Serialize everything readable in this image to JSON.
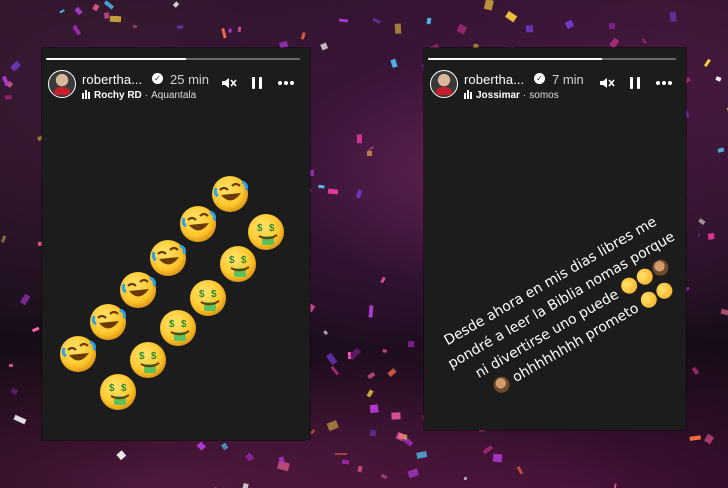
{
  "stories": [
    {
      "username": "robertha...",
      "time": "25 min",
      "song": "Rochy RD",
      "artist": "Aquantala",
      "progress_fraction": 0.55,
      "emojis": {
        "rofl_count": 7,
        "money_face_count": 7
      }
    },
    {
      "username": "robertha...",
      "time": "7 min",
      "song": "Jossimar",
      "artist": "somos",
      "progress_fraction": 0.7,
      "text_lines": [
        "Desde ahora en mis dias libres me",
        "pondré a leer la Biblia nomas porque",
        "ni divertirse uno puede",
        "ohhhhhhhh prometo"
      ]
    }
  ],
  "icons": {
    "verified": "verified-badge-icon",
    "music": "music-bars-icon",
    "mute": "speaker-muted-icon",
    "pause": "pause-icon",
    "more": "more-dots-icon",
    "rofl": "rolling-laughing-emoji",
    "money": "money-mouth-face-emoji",
    "man": "man-facepalming-emoji"
  }
}
